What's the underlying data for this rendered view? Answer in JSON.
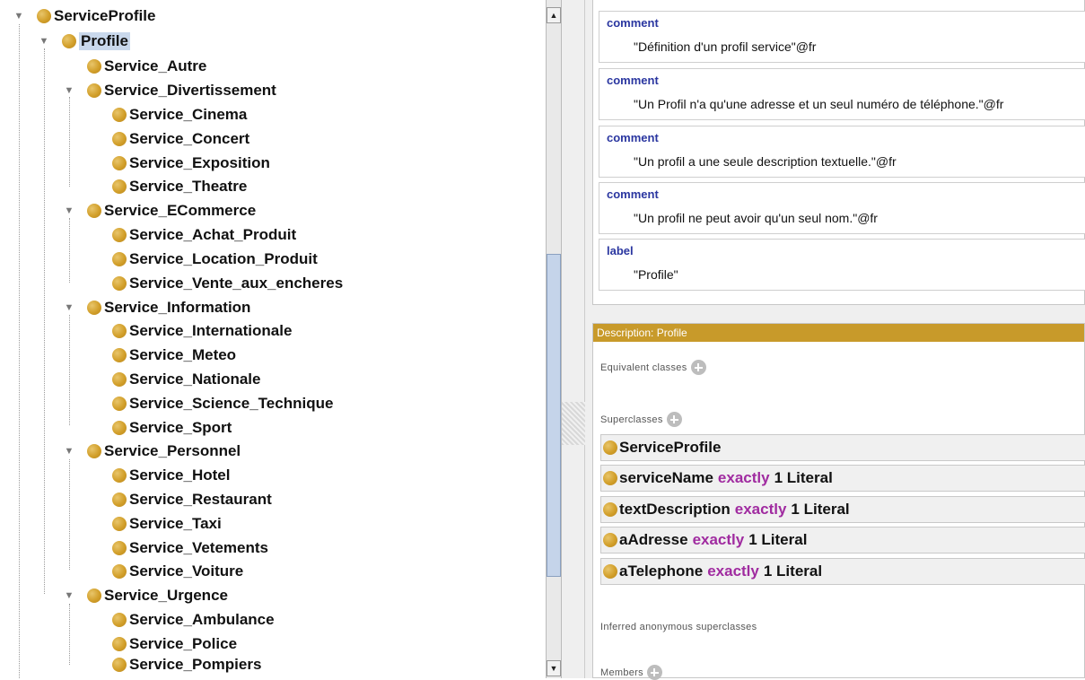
{
  "tree": {
    "nodes": [
      {
        "label": "ServiceProfile",
        "expanded": true
      },
      {
        "label": "Profile",
        "expanded": true,
        "selected": true
      },
      {
        "label": "Service_Autre"
      },
      {
        "label": "Service_Divertissement",
        "expanded": true
      },
      {
        "label": "Service_Cinema"
      },
      {
        "label": "Service_Concert"
      },
      {
        "label": "Service_Exposition"
      },
      {
        "label": "Service_Theatre"
      },
      {
        "label": "Service_ECommerce",
        "expanded": true
      },
      {
        "label": "Service_Achat_Produit"
      },
      {
        "label": "Service_Location_Produit"
      },
      {
        "label": "Service_Vente_aux_encheres"
      },
      {
        "label": "Service_Information",
        "expanded": true
      },
      {
        "label": "Service_Internationale"
      },
      {
        "label": "Service_Meteo"
      },
      {
        "label": "Service_Nationale"
      },
      {
        "label": "Service_Science_Technique"
      },
      {
        "label": "Service_Sport"
      },
      {
        "label": "Service_Personnel",
        "expanded": true
      },
      {
        "label": "Service_Hotel"
      },
      {
        "label": "Service_Restaurant"
      },
      {
        "label": "Service_Taxi"
      },
      {
        "label": "Service_Vetements"
      },
      {
        "label": "Service_Voiture"
      },
      {
        "label": "Service_Urgence",
        "expanded": true
      },
      {
        "label": "Service_Ambulance"
      },
      {
        "label": "Service_Police"
      },
      {
        "label": "Service_Pompiers"
      }
    ]
  },
  "annotations": [
    {
      "key": "comment",
      "value": "\"Définition d'un profil service\"@fr"
    },
    {
      "key": "comment",
      "value": "\"Un Profil n'a qu'une adresse et un seul numéro de téléphone.\"@fr"
    },
    {
      "key": "comment",
      "value": "\"Un profil a une seule description textuelle.\"@fr"
    },
    {
      "key": "comment",
      "value": "\"Un profil ne peut avoir qu'un seul nom.\"@fr"
    },
    {
      "key": "label",
      "value": "\"Profile\""
    }
  ],
  "description": {
    "header": "Description: Profile",
    "equivalent_label": "Equivalent classes",
    "superclasses_label": "Superclasses",
    "superclasses": [
      {
        "name": "ServiceProfile",
        "keyword": "",
        "rest": ""
      },
      {
        "name": "serviceName",
        "keyword": "exactly",
        "rest": "1 Literal"
      },
      {
        "name": "textDescription",
        "keyword": "exactly",
        "rest": "1 Literal"
      },
      {
        "name": "aAdresse",
        "keyword": "exactly",
        "rest": "1 Literal"
      },
      {
        "name": "aTelephone",
        "keyword": "exactly",
        "rest": "1 Literal"
      }
    ],
    "inferred_label": "Inferred anonymous superclasses",
    "members_label": "Members"
  },
  "colors": {
    "class_dot": "#d29f2a",
    "keyword": "#a02ba0",
    "header": "#c89a2a",
    "selection": "#c9d8ec"
  },
  "icons": {
    "expanded": "triangle-down-icon",
    "add": "plus-circle-icon"
  }
}
